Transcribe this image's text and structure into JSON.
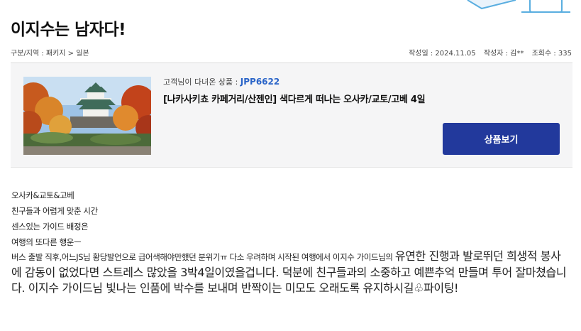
{
  "colors": {
    "accent": "#22399c",
    "code": "#2a64c8",
    "box_bg": "#f5f5f6"
  },
  "decoration_icon": "travel-card-illustration",
  "post": {
    "title": "이지수는 남자다!",
    "category": "구분/지역 : 패키지 > 일본",
    "date": "작성일 : 2024.11.05",
    "author": "작성자 : 김**",
    "views": "조회수 : 335"
  },
  "product": {
    "label": "고객님이 다녀온 상품 : ",
    "code": "JPP6622",
    "name": "[나카사키쵸 카페거리/산젠인] 색다르게 떠나는 오사카/교토/고베 4일",
    "button": "상품보기",
    "image_icon": "osaka-castle-photo"
  },
  "review": {
    "lines": [
      "오사카&교토&고베",
      "친구들과 어렵게 맞춘 시간",
      "센스있는 가이드 배정은",
      "여행의 또다른 행운ㅡ"
    ],
    "para_small": "버스 출발 직후,어느JS님 황당발언으로 급어색해야만했던 분위기ㅠ 다소 우려하며 시작된 여행에서 이지수 가이드님의 ",
    "para_big": "유연한 진행과 발로뛰던 희생적 봉사에 감동이 없었다면 스트레스 많았을 3박4일이였을겁니다. 덕분에 친구들과의 소중하고 예쁜추억 만들며 투어 잘마쳤습니다. 이지수 가이드님 빛나는 인품에 박수를 보내며 반짝이는 미모도 오래도록 유지하시길♧파이팅!"
  }
}
